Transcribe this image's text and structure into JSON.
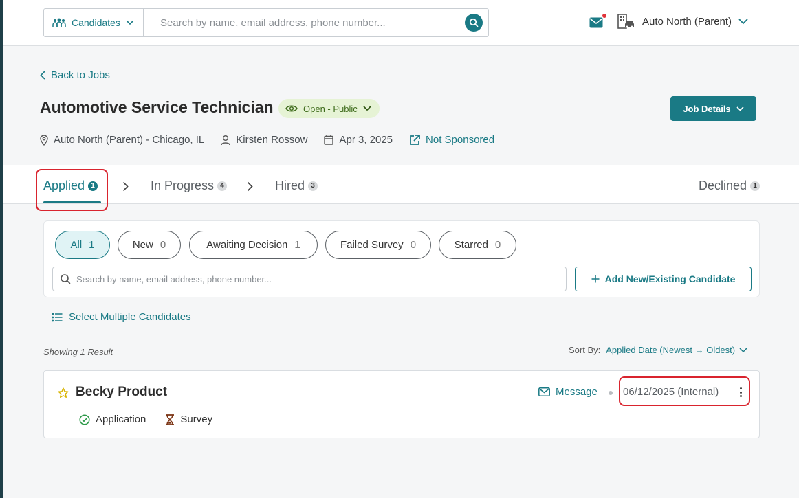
{
  "topbar": {
    "entity_select": "Candidates",
    "search_placeholder": "Search by name, email address, phone number...",
    "org_name": "Auto North (Parent)"
  },
  "job": {
    "back_label": "Back to Jobs",
    "title": "Automotive Service Technician",
    "status": "Open - Public",
    "details_button": "Job Details",
    "location": "Auto North (Parent) - Chicago, IL",
    "recruiter": "Kirsten Rossow",
    "date": "Apr 3, 2025",
    "sponsorship": "Not Sponsored"
  },
  "tabs": [
    {
      "label": "Applied",
      "count": "1"
    },
    {
      "label": "In Progress",
      "count": "4"
    },
    {
      "label": "Hired",
      "count": "3"
    },
    {
      "label": "Declined",
      "count": "1"
    }
  ],
  "filters": [
    {
      "label": "All",
      "count": "1"
    },
    {
      "label": "New",
      "count": "0"
    },
    {
      "label": "Awaiting Decision",
      "count": "1"
    },
    {
      "label": "Failed Survey",
      "count": "0"
    },
    {
      "label": "Starred",
      "count": "0"
    }
  ],
  "candidate_search_placeholder": "Search by name, email address, phone number...",
  "add_candidate_label": "Add New/Existing Candidate",
  "select_multiple_label": "Select Multiple Candidates",
  "results_text": "Showing 1 Result",
  "sort": {
    "label": "Sort By:",
    "value": "Applied Date (Newest → Oldest)"
  },
  "candidate": {
    "name": "Becky Product",
    "message_label": "Message",
    "applied_date": "06/12/2025 (Internal)",
    "steps": [
      "Application",
      "Survey"
    ]
  },
  "colors": {
    "brand": "#1a7a85",
    "highlight": "#d9242e",
    "status_bg": "#e6f3d5"
  }
}
